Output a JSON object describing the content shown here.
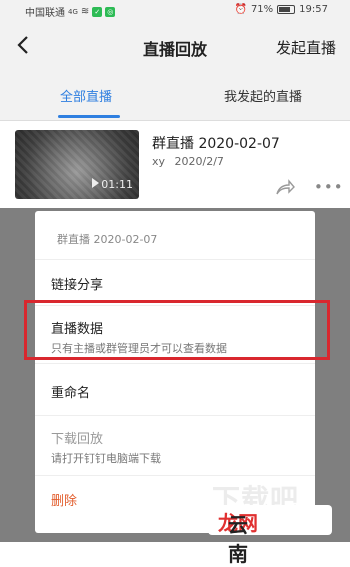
{
  "status_bar": {
    "carrier": "中国联通",
    "signal": "4G",
    "battery": "71%",
    "time": "19:57"
  },
  "header": {
    "back_icon": "chevron-left-icon",
    "title": "直播回放",
    "action_label": "发起直播"
  },
  "tabs": [
    {
      "label": "全部直播",
      "active": true
    },
    {
      "label": "我发起的直播",
      "active": false
    }
  ],
  "live_item": {
    "title": "群直播 2020-02-07",
    "author": "xy",
    "date": "2020/2/7",
    "duration": "01:11"
  },
  "menu": {
    "header": "群直播 2020-02-07",
    "items": [
      {
        "label": "链接分享"
      },
      {
        "label": "直播数据",
        "sub": "只有主播或群管理员才可以查看数据",
        "highlighted": true
      },
      {
        "label": "重命名"
      },
      {
        "label": "下载回放",
        "sub": "请打开钉钉电脑端下载",
        "disabled": true
      },
      {
        "label": "删除",
        "danger": true
      }
    ]
  },
  "watermark": {
    "top": "下载吧",
    "bottom_main": "云南",
    "bottom_accent": "龙网"
  },
  "colors": {
    "accent": "#2f7fe0",
    "danger": "#e25c2b",
    "highlight_box": "#d9272e"
  }
}
